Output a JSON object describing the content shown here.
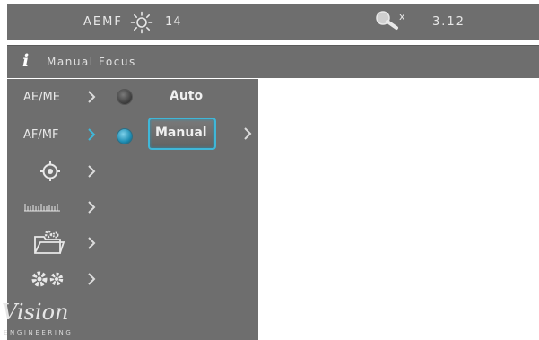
{
  "topbar": {
    "mode": "AEMF",
    "brightness": "14",
    "zoom_prefix": "x",
    "zoom": "3.12"
  },
  "infobar": {
    "info_icon": "i",
    "title": "Manual Focus"
  },
  "sidebar": {
    "items": [
      {
        "label": "AE/ME",
        "icon": ""
      },
      {
        "label": "AF/MF",
        "icon": ""
      },
      {
        "label": "",
        "icon": "crosshair-icon"
      },
      {
        "label": "",
        "icon": "ruler-icon"
      },
      {
        "label": "",
        "icon": "folder-gear-icon"
      },
      {
        "label": "",
        "icon": "settings-gears-icon"
      }
    ]
  },
  "options": [
    {
      "label": "Auto",
      "selected": false
    },
    {
      "label": "Manual",
      "selected": true
    }
  ],
  "logo": {
    "word": "Vision",
    "subtitle": "ENGINEERING"
  },
  "colors": {
    "panel": "#6e6e6e",
    "accent": "#3fb7d8",
    "background": "#ffffff"
  }
}
